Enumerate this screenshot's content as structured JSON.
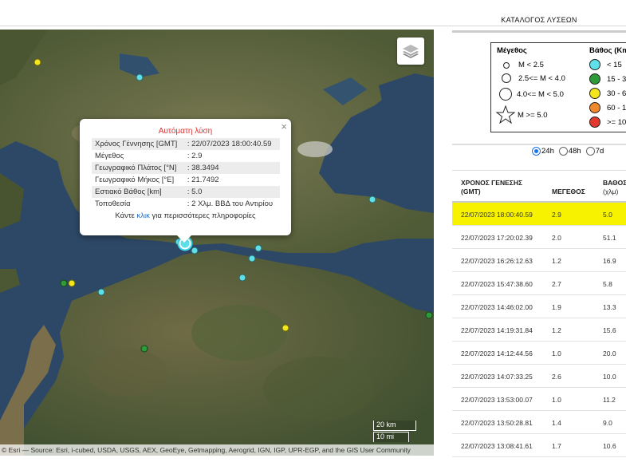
{
  "panel": {
    "title": "ΚΑΤΑΛΟΓΟΣ ΛΥΣΕΩΝ",
    "legend": {
      "magnitude_header": "Μέγεθος",
      "depth_header": "Βάθος (Km",
      "magnitude_items": [
        "M < 2.5",
        "2.5<= M < 4.0",
        "4.0<= M < 5.0",
        "M >= 5.0"
      ],
      "depth_items": [
        {
          "label": "< 15",
          "color": "#5ee0e8"
        },
        {
          "label": "15 - 3",
          "color": "#2e9a3a"
        },
        {
          "label": "30 - 6",
          "color": "#f3e61c"
        },
        {
          "label": "60 - 1",
          "color": "#f0892c"
        },
        {
          "label": ">= 10",
          "color": "#e23a2f"
        }
      ]
    },
    "periods": {
      "opt1": "24h",
      "opt2": "48h",
      "opt3": "7d",
      "selected": "24h"
    },
    "table": {
      "col_time_1": "ΧΡΟΝΟΣ ΓΕΝΕΣΗΣ",
      "col_time_2": "(GMT)",
      "col_mag": "ΜΕΓΕΘΟΣ",
      "col_depth_1": "ΒΑΘΟΣ",
      "col_depth_2": "(χλμ)",
      "rows": [
        {
          "time": "22/07/2023 18:00:40.59",
          "mag": "2.9",
          "depth": "5.0"
        },
        {
          "time": "22/07/2023 17:20:02.39",
          "mag": "2.0",
          "depth": "51.1"
        },
        {
          "time": "22/07/2023 16:26:12.63",
          "mag": "1.2",
          "depth": "16.9"
        },
        {
          "time": "22/07/2023 15:47:38.60",
          "mag": "2.7",
          "depth": "5.8"
        },
        {
          "time": "22/07/2023 14:46:02.00",
          "mag": "1.9",
          "depth": "13.3"
        },
        {
          "time": "22/07/2023 14:19:31.84",
          "mag": "1.2",
          "depth": "15.6"
        },
        {
          "time": "22/07/2023 14:12:44.56",
          "mag": "1.0",
          "depth": "20.0"
        },
        {
          "time": "22/07/2023 14:07:33.25",
          "mag": "2.6",
          "depth": "10.0"
        },
        {
          "time": "22/07/2023 13:53:00.07",
          "mag": "1.0",
          "depth": "11.2"
        },
        {
          "time": "22/07/2023 13:50:28.81",
          "mag": "1.4",
          "depth": "9.0"
        },
        {
          "time": "22/07/2023 13:08:41.61",
          "mag": "1.7",
          "depth": "10.6"
        }
      ]
    }
  },
  "popup": {
    "title": "Αυτόματη λύση",
    "rows": [
      {
        "label": "Χρόνος Γέννησης [GMT]",
        "value": ": 22/07/2023 18:00:40.59"
      },
      {
        "label": "Μέγεθος",
        "value": ": 2.9"
      },
      {
        "label": "Γεωγραφικό Πλάτος [°N]",
        "value": ": 38.3494"
      },
      {
        "label": "Γεωγραφικό Μήκος [°E]",
        "value": ": 21.7492"
      },
      {
        "label": "Εστιακό Βάθος [km]",
        "value": ": 5.0"
      },
      {
        "label": "Τοποθεσία",
        "value": ": 2 Χλμ. ΒΒΔ του Αντιρίου"
      }
    ],
    "more_pre": "Κάντε ",
    "more_link": "κλικ",
    "more_post": " για περισσότερες πληροφορίες",
    "close": "×"
  },
  "map": {
    "scale_km": "20 km",
    "scale_mi": "10 mi",
    "attribution": "© Esri — Source: Esri, i-cubed, USDA, USGS, AEX, GeoEye, Getmapping, Aerogrid, IGN, IGP, UPR-EGP, and the GIS User Community"
  }
}
